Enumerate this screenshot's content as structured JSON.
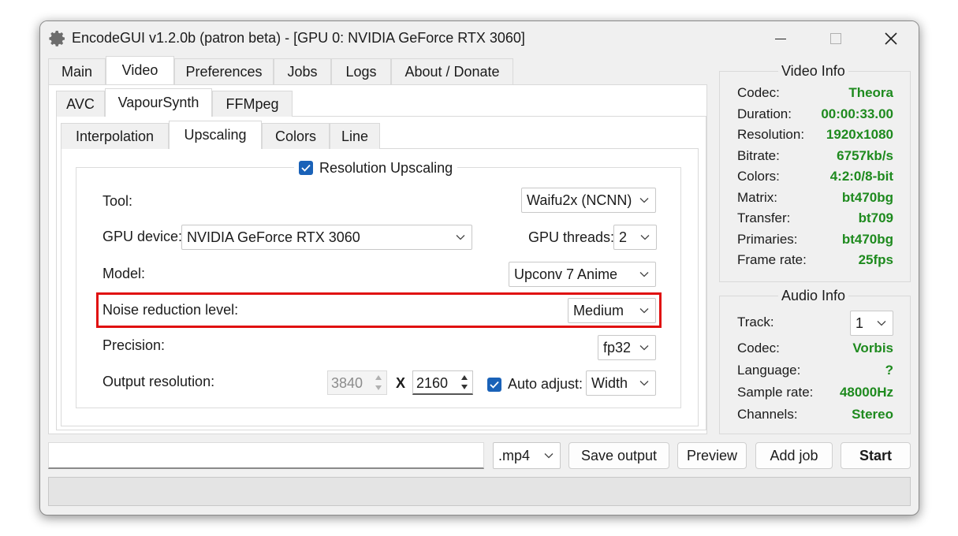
{
  "window": {
    "title": "EncodeGUI v1.2.0b (patron beta) - [GPU 0: NVIDIA GeForce RTX 3060]",
    "controls": {
      "minimize": "—",
      "maximize": "☐",
      "close": "✕"
    }
  },
  "tabs_main": [
    "Main",
    "Video",
    "Preferences",
    "Jobs",
    "Logs",
    "About / Donate"
  ],
  "tabs_video": [
    "AVC",
    "VapourSynth",
    "FFMpeg"
  ],
  "tabs_vs": [
    "Interpolation",
    "Upscaling",
    "Colors",
    "Line"
  ],
  "upscaling": {
    "group_label": "Resolution Upscaling",
    "tool_label": "Tool:",
    "tool_value": "Waifu2x (NCNN)",
    "gpu_device_label": "GPU device:",
    "gpu_device_value": "NVIDIA GeForce RTX 3060",
    "gpu_threads_label": "GPU threads:",
    "gpu_threads_value": "2",
    "model_label": "Model:",
    "model_value": "Upconv 7 Anime",
    "noise_label": "Noise reduction level:",
    "noise_value": "Medium",
    "precision_label": "Precision:",
    "precision_value": "fp32",
    "output_label": "Output resolution:",
    "width_value": "3840",
    "x_sep": "X",
    "height_value": "2160",
    "auto_adjust_label": "Auto adjust:",
    "auto_adjust_value": "Width"
  },
  "video_info": {
    "title": "Video Info",
    "rows": [
      {
        "label": "Codec:",
        "value": "Theora"
      },
      {
        "label": "Duration:",
        "value": "00:00:33.00"
      },
      {
        "label": "Resolution:",
        "value": "1920x1080"
      },
      {
        "label": "Bitrate:",
        "value": "6757kb/s"
      },
      {
        "label": "Colors:",
        "value": "4:2:0/8-bit"
      },
      {
        "label": "Matrix:",
        "value": "bt470bg"
      },
      {
        "label": "Transfer:",
        "value": "bt709"
      },
      {
        "label": "Primaries:",
        "value": "bt470bg"
      },
      {
        "label": "Frame rate:",
        "value": "25fps"
      }
    ]
  },
  "audio_info": {
    "title": "Audio Info",
    "track_label": "Track:",
    "track_value": "1",
    "rows": [
      {
        "label": "Codec:",
        "value": "Vorbis"
      },
      {
        "label": "Language:",
        "value": "?"
      },
      {
        "label": "Sample rate:",
        "value": "48000Hz"
      },
      {
        "label": "Channels:",
        "value": "Stereo"
      }
    ]
  },
  "bottom": {
    "output_path": "",
    "container": ".mp4",
    "save_output": "Save output",
    "preview": "Preview",
    "add_job": "Add job",
    "start": "Start"
  },
  "colors": {
    "accent": "#1a62b8",
    "value_green": "#1e8a1e",
    "highlight_red": "#e01010"
  },
  "icons": [
    "gear-icon",
    "chevron-down-icon",
    "checkmark-icon",
    "spin-up-icon",
    "spin-down-icon"
  ]
}
